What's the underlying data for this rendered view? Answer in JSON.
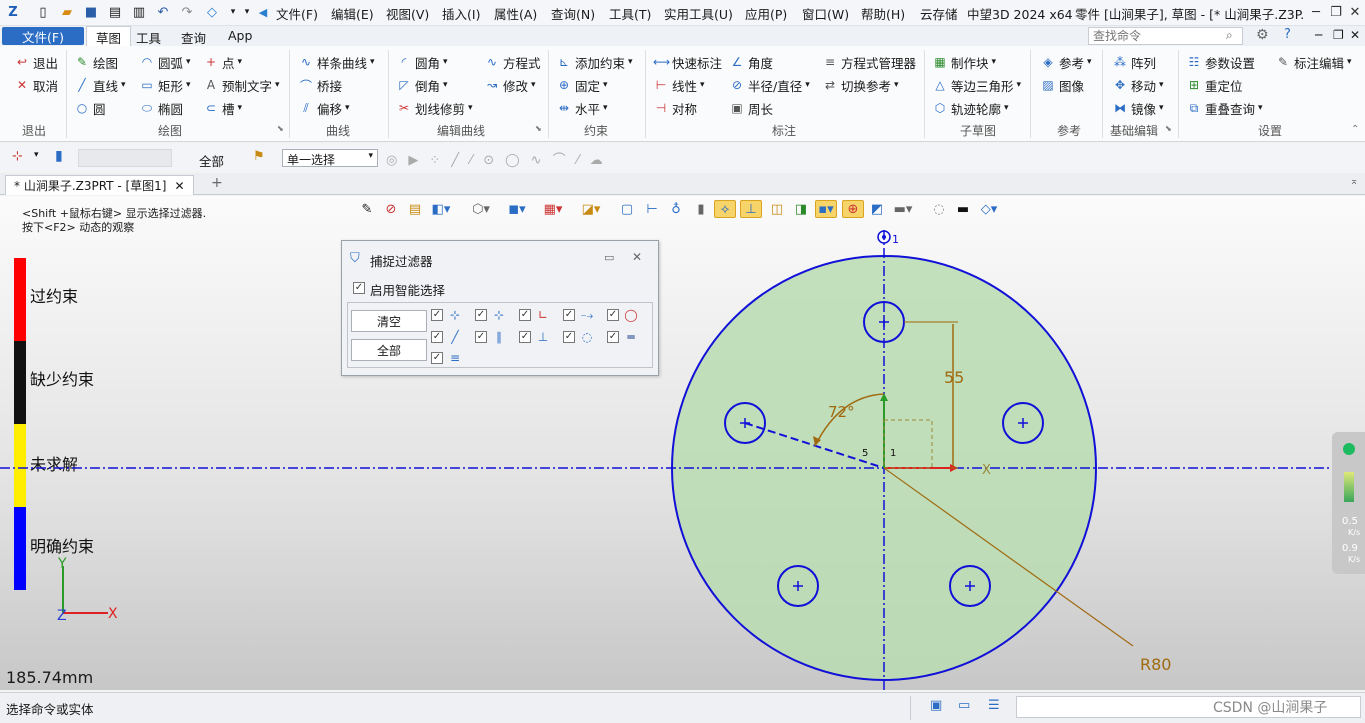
{
  "app": {
    "title": "中望3D 2024 x64",
    "doc_title": "零件 [山涧果子], 草图 - [* 山涧果子.Z3P...",
    "cloud": "云存储"
  },
  "menu": [
    "文件(F)",
    "编辑(E)",
    "视图(V)",
    "插入(I)",
    "属性(A)",
    "查询(N)",
    "工具(T)",
    "实用工具(U)",
    "应用(P)",
    "窗口(W)",
    "帮助(H)"
  ],
  "ribbon_tabs": {
    "file": "文件(F)",
    "tabs": [
      "草图",
      "工具",
      "查询",
      "App"
    ],
    "active": "草图"
  },
  "search": {
    "placeholder": "查找命令"
  },
  "ribbon": {
    "exit": {
      "items": [
        "退出",
        "取消"
      ],
      "label": "退出"
    },
    "draw": {
      "items": [
        "绘图",
        "直线",
        "圆",
        "圆弧",
        "矩形",
        "椭圆",
        "点",
        "预制文字",
        "槽"
      ],
      "label": "绘图"
    },
    "curve": {
      "items": [
        "样条曲线",
        "桥接",
        "偏移"
      ],
      "label": "曲线"
    },
    "edit": {
      "items": [
        "圆角",
        "倒角",
        "划线修剪",
        "方程式",
        "修改"
      ],
      "label": "编辑曲线"
    },
    "constraint": {
      "items": [
        "添加约束",
        "固定",
        "水平"
      ],
      "label": "约束"
    },
    "dimension": {
      "items": [
        "快速标注",
        "线性",
        "对称",
        "角度",
        "半径/直径",
        "周长",
        "方程式管理器",
        "切换参考"
      ],
      "label": "标注"
    },
    "subsketch": {
      "items": [
        "制作块",
        "等边三角形",
        "轨迹轮廓"
      ],
      "label": "子草图"
    },
    "ref": {
      "items": [
        "参考",
        "图像"
      ],
      "label": "参考"
    },
    "basic": {
      "items": [
        "阵列",
        "移动",
        "镜像"
      ],
      "label": "基础编辑"
    },
    "settings": {
      "items": [
        "参数设置",
        "重定位",
        "重叠查询",
        "标注编辑"
      ],
      "label": "设置"
    }
  },
  "toolbar2": {
    "filter": "全部",
    "select_mode": "单一选择"
  },
  "doc_tab": {
    "label": "* 山涧果子.Z3PRT - [草图1]",
    "close": "✕",
    "add": "+"
  },
  "hint": {
    "line1": "<Shift +鼠标右键> 显示选择过滤器.",
    "line2": "按下<F2> 动态的观察"
  },
  "legend": [
    {
      "label": "过约束",
      "color": "#ff0000"
    },
    {
      "label": "缺少约束",
      "color": "#111111"
    },
    {
      "label": "未求解",
      "color": "#ffee00"
    },
    {
      "label": "明确约束",
      "color": "#0000ff"
    }
  ],
  "snap_filter": {
    "title": "捕捉过滤器",
    "smart": "启用智能选择",
    "clear": "清空",
    "all": "全部"
  },
  "sketch": {
    "angle": "72°",
    "dim_vertical": "55",
    "radius": "R80",
    "origin_label": "1",
    "axis_x": "X",
    "small_5": "5",
    "small_1": "1"
  },
  "axes": {
    "x": "X",
    "y": "Y",
    "z": "Z"
  },
  "scale": "185.74mm",
  "right_panel": {
    "v1": "0.5",
    "u1": "K/s",
    "v2": "0.9",
    "u2": "K/s"
  },
  "status": {
    "prompt": "选择命令或实体",
    "watermark": "CSDN @山涧果子"
  }
}
